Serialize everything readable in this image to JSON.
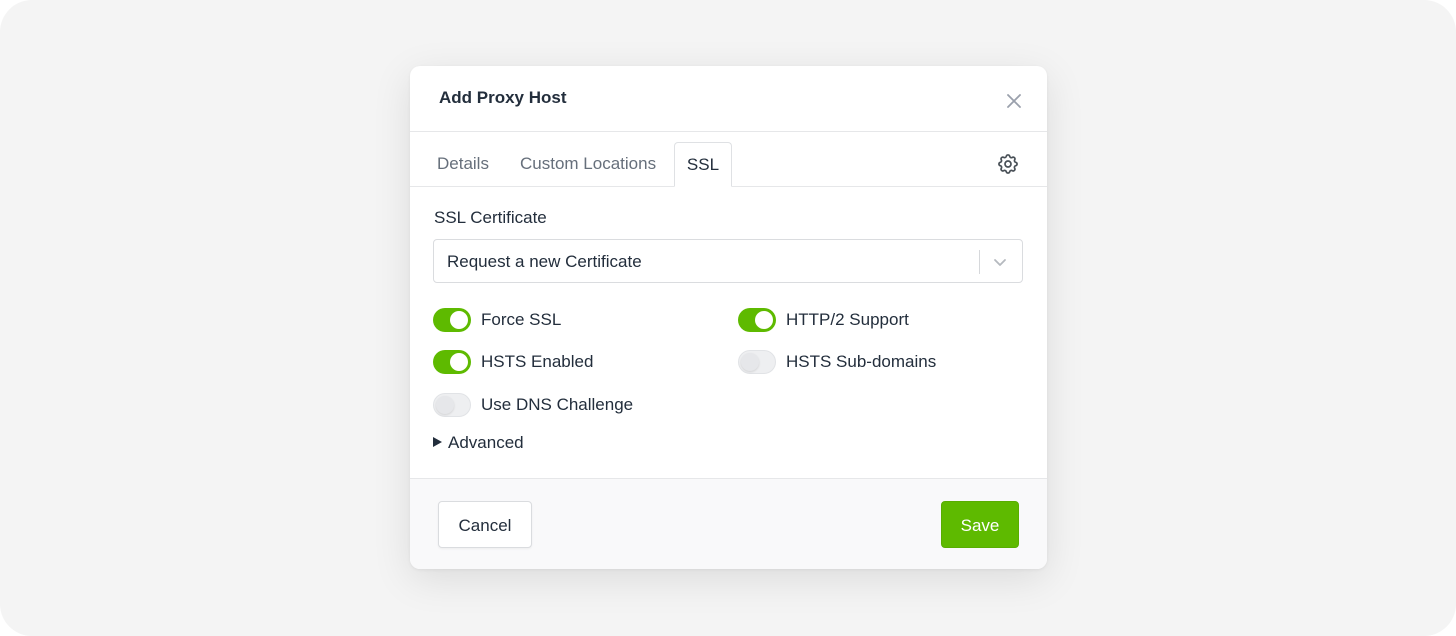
{
  "modal": {
    "title": "Add Proxy Host",
    "close_icon": "close-icon"
  },
  "tabs": [
    {
      "label": "Details",
      "active": false
    },
    {
      "label": "Custom Locations",
      "active": false
    },
    {
      "label": "SSL",
      "active": true
    }
  ],
  "settings_icon": "gear-icon",
  "ssl": {
    "label": "SSL Certificate",
    "selected": "Request a new Certificate",
    "dropdown_icon": "chevron-down-icon"
  },
  "toggles": [
    {
      "label": "Force SSL",
      "checked": true
    },
    {
      "label": "HTTP/2 Support",
      "checked": true
    },
    {
      "label": "HSTS Enabled",
      "checked": true
    },
    {
      "label": "HSTS Sub-domains",
      "checked": false
    },
    {
      "label": "Use DNS Challenge",
      "checked": false
    }
  ],
  "advanced": {
    "label": "Advanced",
    "icon": "triangle-right-icon"
  },
  "footer": {
    "cancel_label": "Cancel",
    "save_label": "Save"
  },
  "colors": {
    "accent": "#5eba00",
    "text": "#232e3c",
    "muted_text": "#666f7b"
  }
}
